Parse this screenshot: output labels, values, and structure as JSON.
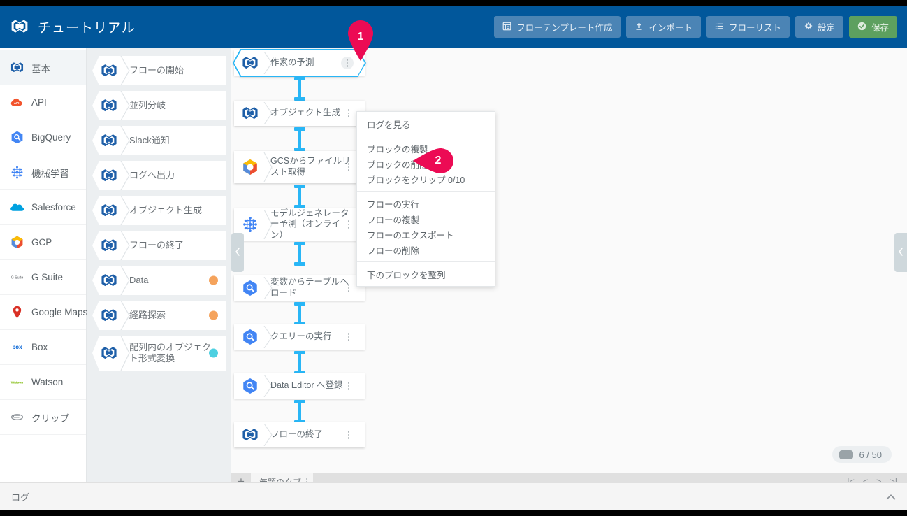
{
  "app": {
    "brand_title": "チュートリアル",
    "brand_logo_icon": "trocco-logo-icon"
  },
  "topbar": {
    "buttons": [
      {
        "label": "フローテンプレート作成",
        "icon": "template-icon",
        "style": "normal"
      },
      {
        "label": "インポート",
        "icon": "upload-icon",
        "style": "normal"
      },
      {
        "label": "フローリスト",
        "icon": "list-icon",
        "style": "normal"
      },
      {
        "label": "設定",
        "icon": "gear-icon",
        "style": "normal"
      },
      {
        "label": "保存",
        "icon": "check-circle-icon",
        "style": "save"
      }
    ]
  },
  "sidebar": {
    "items": [
      {
        "label": "基本",
        "icon": "trocco-logo-icon",
        "active": true
      },
      {
        "label": "API",
        "icon": "api-cloud-icon",
        "active": false
      },
      {
        "label": "BigQuery",
        "icon": "bigquery-icon",
        "active": false
      },
      {
        "label": "機械学習",
        "icon": "machine-learning-icon",
        "active": false
      },
      {
        "label": "Salesforce",
        "icon": "salesforce-cloud-icon",
        "active": false
      },
      {
        "label": "GCP",
        "icon": "gcp-icon",
        "active": false
      },
      {
        "label": "G Suite",
        "icon": "gsuite-icon",
        "active": false
      },
      {
        "label": "Google Maps",
        "icon": "map-pin-icon",
        "active": false
      },
      {
        "label": "Box",
        "icon": "box-icon",
        "active": false
      },
      {
        "label": "Watson",
        "icon": "watson-icon",
        "active": false
      },
      {
        "label": "クリップ",
        "icon": "clip-icon",
        "active": false
      }
    ]
  },
  "palette": {
    "items": [
      {
        "label": "フローの開始",
        "icon": "trocco-logo-icon",
        "badge": null
      },
      {
        "label": "並列分岐",
        "icon": "trocco-logo-icon",
        "badge": null
      },
      {
        "label": "Slack通知",
        "icon": "trocco-logo-icon",
        "badge": null
      },
      {
        "label": "ログへ出力",
        "icon": "trocco-logo-icon",
        "badge": null
      },
      {
        "label": "オブジェクト生成",
        "icon": "trocco-logo-icon",
        "badge": null
      },
      {
        "label": "フローの終了",
        "icon": "trocco-logo-icon",
        "badge": null
      },
      {
        "label": "Data",
        "icon": "trocco-logo-icon",
        "badge": {
          "color": "#f5a35c",
          "text": ""
        }
      },
      {
        "label": "経路探索",
        "icon": "trocco-logo-icon",
        "badge": {
          "color": "#f5a35c",
          "text": ""
        }
      },
      {
        "label": "配列内のオブジェクト形式変換",
        "icon": "trocco-logo-icon",
        "badge": {
          "color": "#4dd0e1",
          "text": ""
        }
      }
    ]
  },
  "canvas": {
    "blocks": [
      {
        "label": "作家の予測",
        "icon": "trocco-logo-icon",
        "selected": true,
        "tall": false
      },
      {
        "label": "オブジェクト生成",
        "icon": "trocco-logo-icon",
        "selected": false,
        "tall": false
      },
      {
        "label": "GCSからファイルリスト取得",
        "icon": "gcp-icon",
        "selected": false,
        "tall": true
      },
      {
        "label": "モデルジェネレーター予測（オンライン）",
        "icon": "machine-learning-icon",
        "selected": false,
        "tall": true
      },
      {
        "label": "変数からテーブルへロード",
        "icon": "bigquery-icon",
        "selected": false,
        "tall": false
      },
      {
        "label": "クエリーの実行",
        "icon": "bigquery-icon",
        "selected": false,
        "tall": false
      },
      {
        "label": "Data Editor へ登録",
        "icon": "bigquery-icon",
        "selected": false,
        "tall": false
      },
      {
        "label": "フローの終了",
        "icon": "trocco-logo-icon",
        "selected": false,
        "tall": false
      }
    ],
    "zoom_label": "6 / 50",
    "left_handle_icon": "chevron-left-icon",
    "right_handle_icon": "chevron-left-icon"
  },
  "context_menu": {
    "groups": [
      {
        "items": [
          {
            "label": "ログを見る"
          }
        ]
      },
      {
        "items": [
          {
            "label": "ブロックの複製"
          },
          {
            "label": "ブロックの削除"
          },
          {
            "label": "ブロックをクリップ 0/10"
          }
        ]
      },
      {
        "items": [
          {
            "label": "フローの実行"
          },
          {
            "label": "フローの複製"
          },
          {
            "label": "フローのエクスポート"
          },
          {
            "label": "フローの削除"
          }
        ]
      },
      {
        "items": [
          {
            "label": "下のブロックを整列"
          }
        ]
      }
    ]
  },
  "tabstrip": {
    "add_label": "+",
    "tab_label": "無題のタブ",
    "pager": [
      "|<",
      "<",
      ">",
      ">|"
    ]
  },
  "logbar": {
    "label": "ログ",
    "collapse_icon": "chevron-up-icon"
  },
  "markers": [
    {
      "number": "1",
      "color": "#ec0b54"
    },
    {
      "number": "2",
      "color": "#ec0b54"
    }
  ],
  "colors": {
    "topbar_bg": "#01579b",
    "accent_blue": "#29b6f6",
    "marker_pink": "#ec0b54",
    "save_green": "#5da05f"
  }
}
